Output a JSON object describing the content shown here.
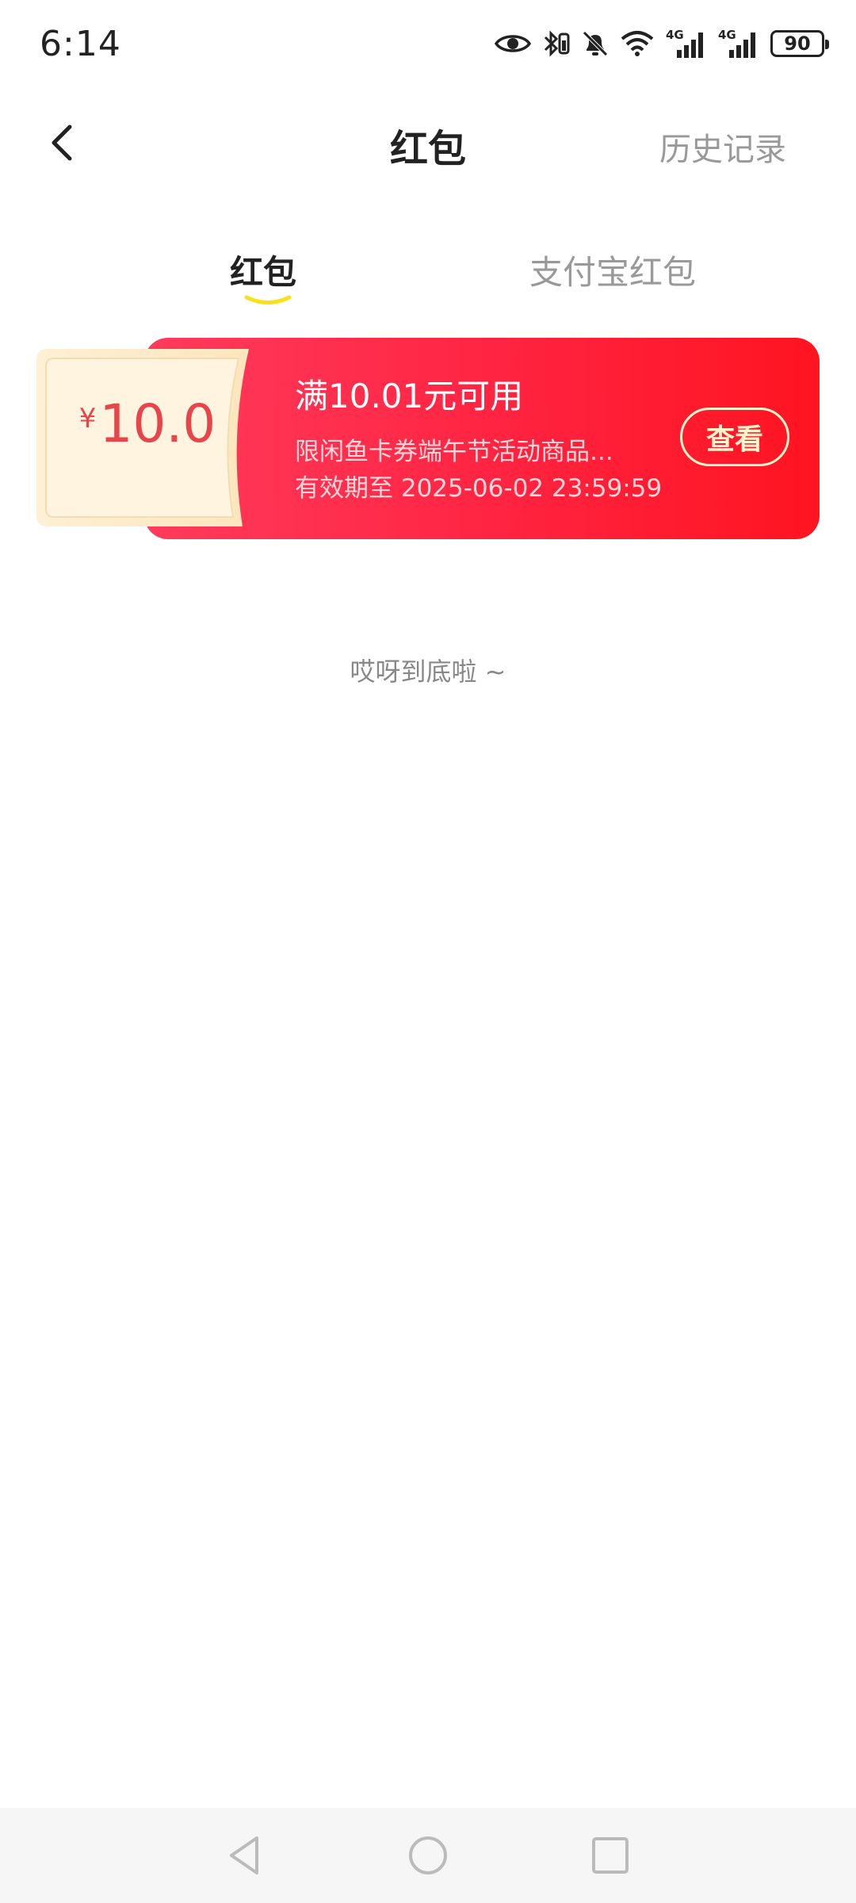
{
  "status_bar": {
    "time": "6:14",
    "network_tag_1": "4G",
    "network_tag_2": "4G",
    "battery": "90"
  },
  "header": {
    "title": "红包",
    "history_link": "历史记录"
  },
  "tabs": [
    {
      "label": "红包",
      "active": true
    },
    {
      "label": "支付宝红包",
      "active": false
    }
  ],
  "coupon": {
    "currency_symbol": "¥",
    "amount": "10.0",
    "title": "满10.01元可用",
    "description": "限闲鱼卡券端午节活动商品...",
    "expiry": "有效期至 2025-06-02 23:59:59",
    "action_label": "查看"
  },
  "end_hint": "哎呀到底啦 ~",
  "colors": {
    "accent_yellow": "#f5e21d",
    "coupon_red": "#ff1f3a",
    "amount_red": "#e6454a"
  }
}
